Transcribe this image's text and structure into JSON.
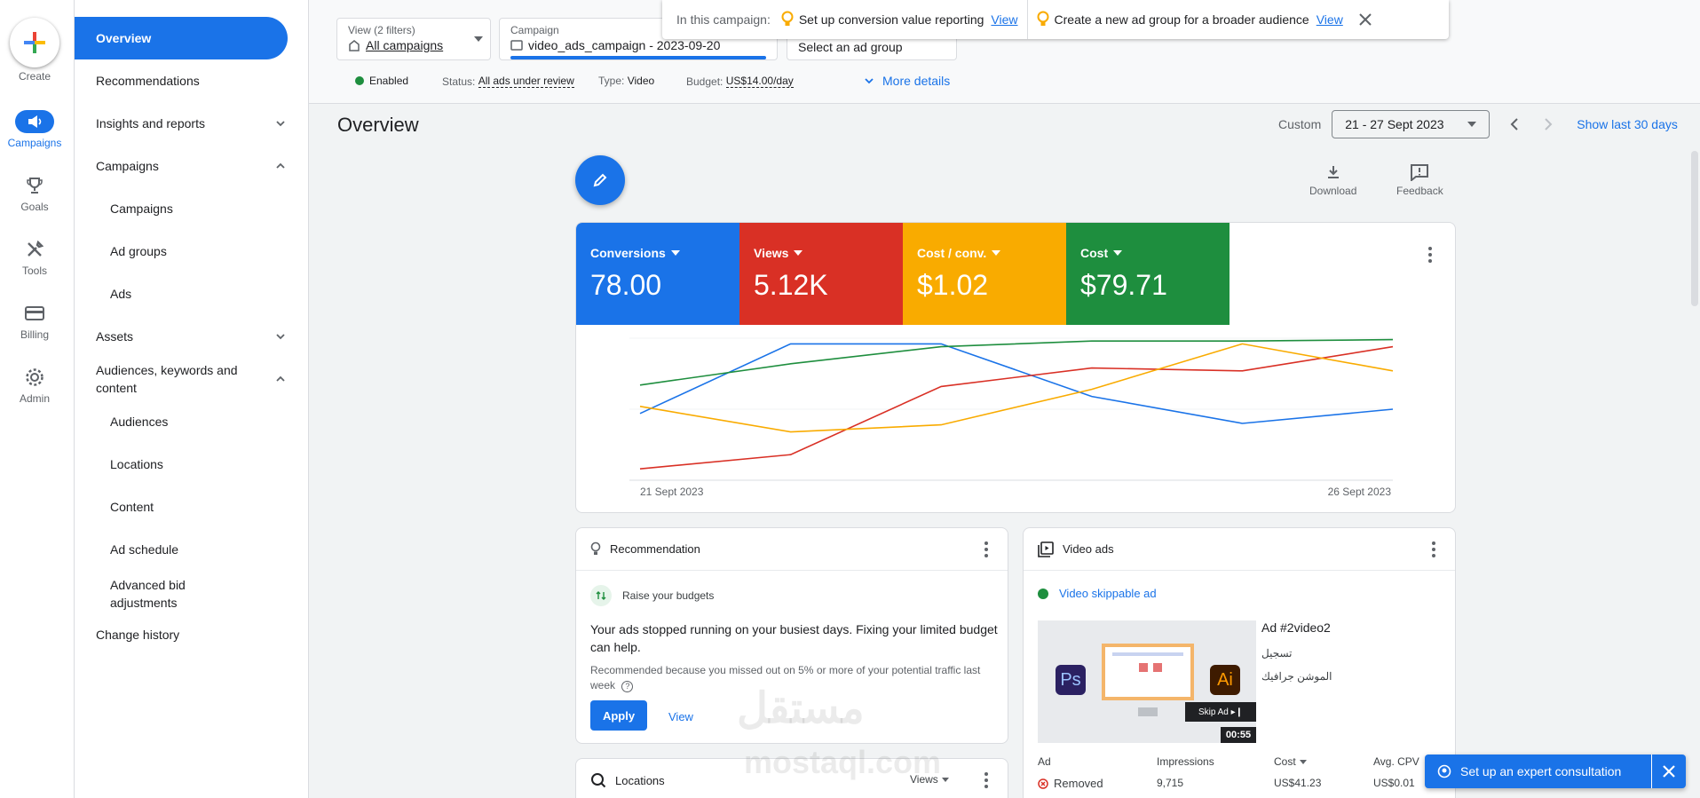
{
  "rail": {
    "create": "Create",
    "campaigns": "Campaigns",
    "goals": "Goals",
    "tools": "Tools",
    "billing": "Billing",
    "admin": "Admin"
  },
  "nav": {
    "overview": "Overview",
    "recommendations": "Recommendations",
    "insights": "Insights and reports",
    "campaigns_group": "Campaigns",
    "campaigns": "Campaigns",
    "ad_groups": "Ad groups",
    "ads": "Ads",
    "assets": "Assets",
    "audiences_group": "Audiences, keywords and content",
    "audiences": "Audiences",
    "locations": "Locations",
    "content": "Content",
    "ad_schedule": "Ad schedule",
    "advanced_bid": "Advanced bid adjustments",
    "change_history": "Change history"
  },
  "filters": {
    "view_label": "View (2 filters)",
    "view_value": "All campaigns",
    "campaign_label": "Campaign",
    "campaign_value": "video_ads_campaign - 2023-09-20",
    "adgroup_value": "Select an ad group"
  },
  "status": {
    "enabled": "Enabled",
    "status_label": "Status:",
    "status_value": "All ads under review",
    "type_label": "Type:",
    "type_value": "Video",
    "budget_label": "Budget:",
    "budget_value": "US$14.00/day",
    "more_details": "More details"
  },
  "notification": {
    "prefix": "In this campaign:",
    "item1": "Set up conversion value reporting",
    "item1_link": "View",
    "item2": "Create a new ad group for a broader audience",
    "item2_link": "View"
  },
  "header": {
    "title": "Overview",
    "custom": "Custom",
    "date_range": "21 - 27 Sept 2023",
    "show_last": "Show last 30 days",
    "download": "Download",
    "feedback": "Feedback"
  },
  "metrics": [
    {
      "label": "Conversions",
      "value": "78.00",
      "color": "#1a73e8"
    },
    {
      "label": "Views",
      "value": "5.12K",
      "color": "#d93025"
    },
    {
      "label": "Cost / conv.",
      "value": "$1.02",
      "color": "#f9ab00"
    },
    {
      "label": "Cost",
      "value": "$79.71",
      "color": "#1e8e3e"
    }
  ],
  "chart_data": {
    "type": "line",
    "x_start_label": "21 Sept 2023",
    "x_end_label": "26 Sept 2023",
    "x": [
      0,
      1,
      2,
      3,
      4,
      5,
      6
    ],
    "series": [
      {
        "name": "Conversions",
        "color": "#1a73e8",
        "values": [
          0.47,
          0.96,
          0.96,
          0.59,
          0.4,
          0.5,
          0.5
        ]
      },
      {
        "name": "Views",
        "color": "#d93025",
        "values": [
          0.08,
          0.18,
          0.66,
          0.79,
          0.77,
          0.94,
          0.94
        ]
      },
      {
        "name": "Cost / conv.",
        "color": "#f9ab00",
        "values": [
          0.52,
          0.34,
          0.39,
          0.64,
          0.96,
          0.77,
          0.77
        ]
      },
      {
        "name": "Cost",
        "color": "#1e8e3e",
        "values": [
          0.67,
          0.82,
          0.94,
          0.98,
          0.98,
          0.99,
          0.99
        ]
      }
    ],
    "x_points": [
      0,
      0.2,
      0.4,
      0.6,
      0.8,
      1.0
    ]
  },
  "recommendation": {
    "header": "Recommendation",
    "subtitle": "Raise your budgets",
    "body": "Your ads stopped running on your busiest days. Fixing your limited budget can help.",
    "reason": "Recommended because you missed out on 5% or more of your potential traffic last week",
    "apply": "Apply",
    "view": "View"
  },
  "video_ads": {
    "header": "Video ads",
    "ad_type": "Video skippable ad",
    "ad_name": "Ad #2video2",
    "line1": "تسجيل",
    "line2": "الموشن جرافيك",
    "duration": "00:55",
    "skip": "Skip Ad",
    "ps": "Ps",
    "ai": "Ai",
    "col_ad": "Ad",
    "col_impr": "Impressions",
    "col_cost": "Cost",
    "col_cpv": "Avg. CPV",
    "row_status": "Removed",
    "row_impr": "9,715",
    "row_cost": "US$41.23",
    "row_cpv": "US$0.01"
  },
  "locations": {
    "header": "Locations",
    "views": "Views"
  },
  "consult": {
    "label": "Set up an expert consultation"
  },
  "watermark": {
    "ar": "مستقل",
    "en": "mostaql.com"
  }
}
